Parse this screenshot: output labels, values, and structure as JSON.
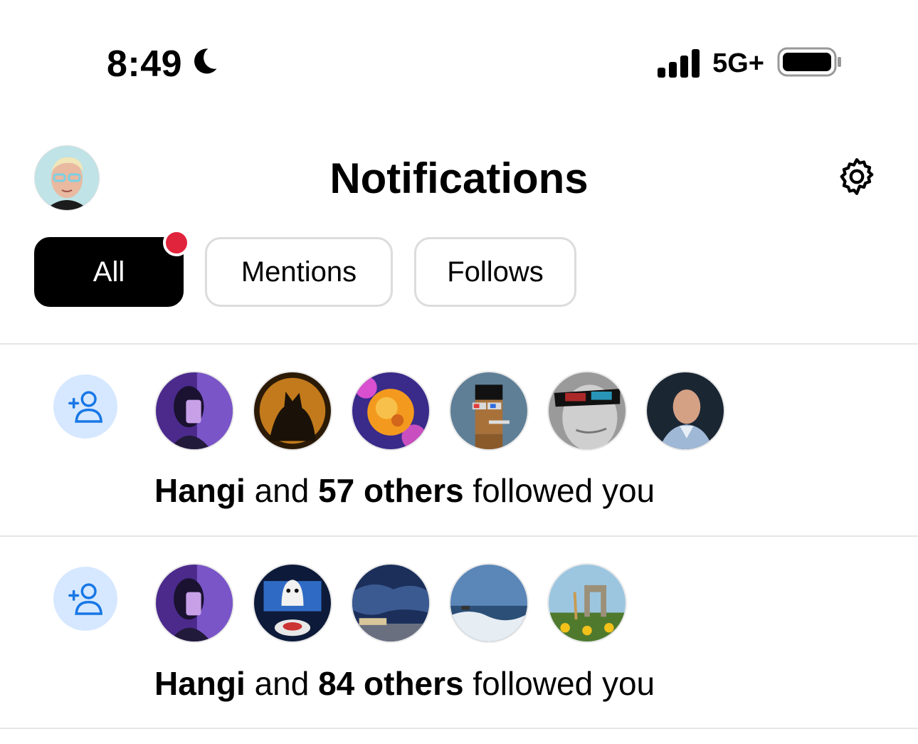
{
  "status_bar": {
    "time": "8:49",
    "focus_icon": "moon-icon",
    "network": "5G+",
    "signal_icon": "cellular-signal-icon",
    "battery_icon": "battery-icon"
  },
  "header": {
    "title": "Notifications",
    "avatar_icon": "profile-avatar",
    "settings_icon": "gear-icon"
  },
  "tabs": [
    {
      "label": "All",
      "active": true,
      "has_unread_dot": true
    },
    {
      "label": "Mentions",
      "active": false
    },
    {
      "label": "Follows",
      "active": false
    }
  ],
  "notifications": [
    {
      "icon": "person-add-icon",
      "name": "Hangi",
      "connector": "and",
      "others": "57 others",
      "action": "followed you",
      "avatar_count": 6
    },
    {
      "icon": "person-add-icon",
      "name": "Hangi",
      "connector": "and",
      "others": "84 others",
      "action": "followed you",
      "avatar_count": 5
    }
  ],
  "colors": {
    "unread_dot": "#e0243c",
    "follow_badge_bg": "#d6e8ff",
    "follow_icon": "#1877e6",
    "active_tab_bg": "#000000"
  }
}
